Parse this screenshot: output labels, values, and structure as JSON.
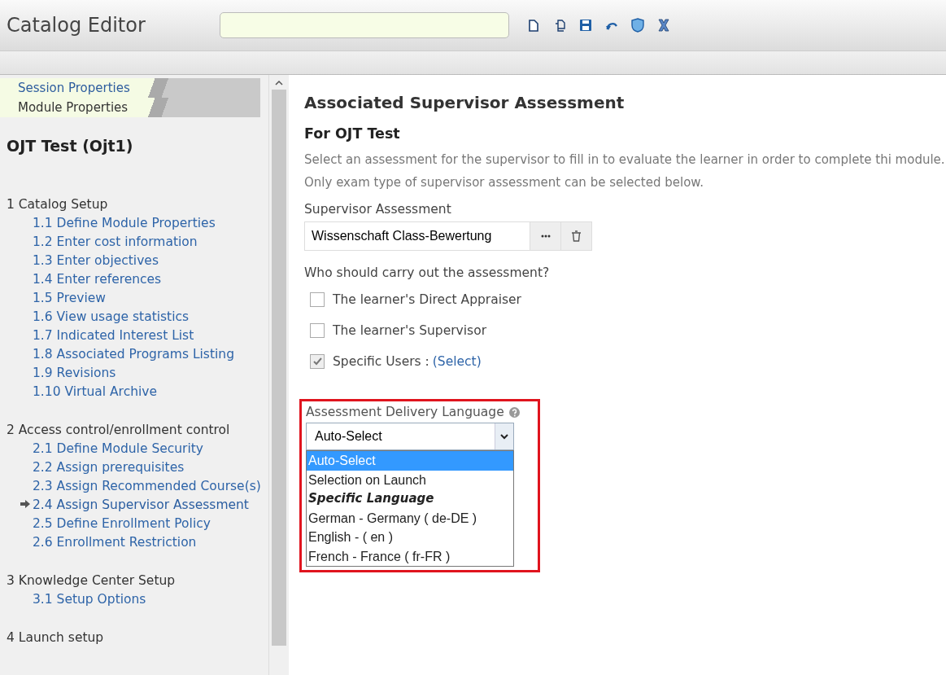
{
  "header": {
    "title": "Catalog Editor",
    "tools": [
      {
        "kind": "new"
      },
      {
        "kind": "copy"
      },
      {
        "kind": "save"
      },
      {
        "kind": "undo"
      },
      {
        "kind": "shield"
      },
      {
        "kind": "close"
      }
    ]
  },
  "sidebar": {
    "tabs": [
      {
        "label": "Session Properties",
        "selected": false
      },
      {
        "label": "Module Properties",
        "selected": true
      }
    ],
    "title": "OJT Test (Ojt1)",
    "sections": [
      {
        "label": "1 Catalog Setup",
        "children": [
          {
            "label": "1.1 Define Module Properties",
            "current": false
          },
          {
            "label": "1.2 Enter cost information",
            "current": false
          },
          {
            "label": "1.3 Enter objectives",
            "current": false
          },
          {
            "label": "1.4 Enter references",
            "current": false
          },
          {
            "label": "1.5 Preview",
            "current": false
          },
          {
            "label": "1.6 View usage statistics",
            "current": false
          },
          {
            "label": "1.7 Indicated Interest List",
            "current": false
          },
          {
            "label": "1.8 Associated Programs Listing",
            "current": false
          },
          {
            "label": "1.9 Revisions",
            "current": false
          },
          {
            "label": "1.10 Virtual Archive",
            "current": false
          }
        ]
      },
      {
        "label": "2 Access control/enrollment control",
        "children": [
          {
            "label": "2.1 Define Module Security",
            "current": false
          },
          {
            "label": "2.2 Assign prerequisites",
            "current": false
          },
          {
            "label": "2.3 Assign Recommended Course(s)",
            "current": false
          },
          {
            "label": "2.4 Assign Supervisor Assessment",
            "current": true
          },
          {
            "label": "2.5 Define Enrollment Policy",
            "current": false
          },
          {
            "label": "2.6 Enrollment Restriction",
            "current": false
          }
        ]
      },
      {
        "label": "3 Knowledge Center Setup",
        "children": [
          {
            "label": "3.1 Setup Options",
            "current": false
          }
        ]
      },
      {
        "label": "4 Launch setup"
      }
    ]
  },
  "main": {
    "title": "Associated Supervisor Assessment",
    "subtitle": "For OJT Test",
    "description": "Select an assessment for the supervisor to fill in to evaluate the learner in order to complete thi module. Only exam type of supervisor assessment can be selected below.",
    "assessment": {
      "label": "Supervisor Assessment",
      "value": "Wissenschaft Class-Bewertung"
    },
    "question": "Who should carry out the assessment?",
    "options": [
      {
        "label": "The learner's Direct Appraiser",
        "checked": false
      },
      {
        "label": "The learner's Supervisor",
        "checked": false
      },
      {
        "label": "Specific Users :",
        "checked": true,
        "link": "(Select)"
      }
    ],
    "language": {
      "label": "Assessment Delivery Language",
      "value": "Auto-Select",
      "highlighted": true,
      "choices": [
        {
          "kind": "option",
          "label": "Auto-Select",
          "selected": true
        },
        {
          "kind": "option",
          "label": "Selection on Launch",
          "selected": false
        },
        {
          "kind": "group",
          "label": "Specific Language",
          "selected": false
        },
        {
          "kind": "option",
          "label": "German - Germany ( de-DE )",
          "selected": false
        },
        {
          "kind": "option",
          "label": "English - ( en )",
          "selected": false
        },
        {
          "kind": "option",
          "label": "French - France ( fr-FR )",
          "selected": false
        }
      ]
    }
  }
}
